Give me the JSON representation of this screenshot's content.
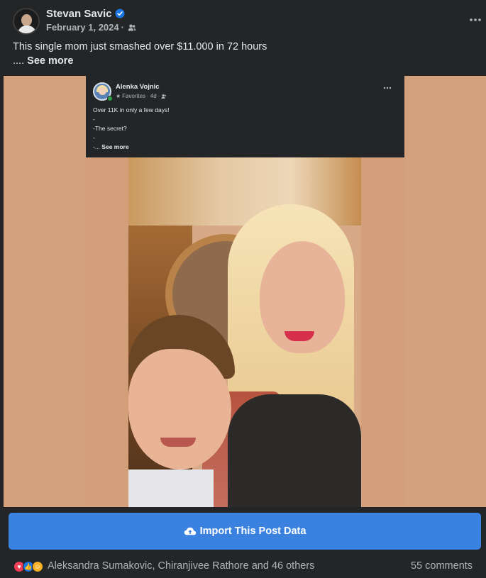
{
  "post": {
    "author": "Stevan Savic",
    "date": "February 1, 2024",
    "date_sep": "·",
    "text": "This single mom just smashed over $11.000 in 72 hours",
    "ellipsis": "....",
    "see_more": "See more"
  },
  "inner_post": {
    "author": "Alenka Vojnic",
    "meta_label": "Favorites",
    "meta_time": "4d",
    "sep": "·",
    "line1": "Over 11K in only a few days!",
    "line2": "-",
    "line3": "-The secret?",
    "line4": "-",
    "line5_prefix": "-...",
    "see_more": "See more"
  },
  "import_button": {
    "label": "Import This Post Data",
    "icon": "cloud-upload-icon",
    "color": "#3b82e0"
  },
  "footer": {
    "reaction_names": "Aleksandra Sumakovic, Chiranjivee Rathore and 46 others",
    "comments": "55 comments",
    "reaction_icons": [
      "love-icon",
      "like-icon",
      "care-icon"
    ]
  },
  "colors": {
    "background": "#242526",
    "media_background": "#d3a17c",
    "verified": "#1b74e4"
  }
}
